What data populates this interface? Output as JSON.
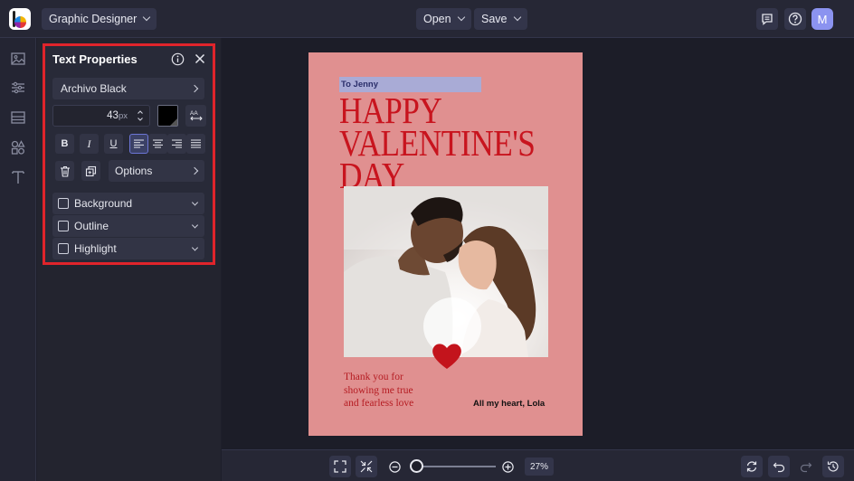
{
  "topbar": {
    "app_mode": "Graphic Designer",
    "open_label": "Open",
    "save_label": "Save",
    "avatar_initial": "M"
  },
  "panel": {
    "title": "Text Properties",
    "font_name": "Archivo Black",
    "font_size": "43",
    "font_unit": "px",
    "text_color": "#000000",
    "format_buttons": {
      "bold": "B",
      "italic": "I",
      "underline": "U"
    },
    "options_label": "Options",
    "sections": [
      {
        "label": "Background",
        "checked": false
      },
      {
        "label": "Outline",
        "checked": false
      },
      {
        "label": "Highlight",
        "checked": false
      }
    ],
    "highlight_color": "#e0242b"
  },
  "card": {
    "to_text": "To Jenny",
    "headline_lines": [
      "HAPPY",
      "VALENTINE'S",
      "DAY"
    ],
    "message": "Thank you for\nshowing me true\nand fearless love",
    "signature": "All my heart, Lola",
    "background_color": "#e09090",
    "headline_color": "#c8141e"
  },
  "zoom": {
    "level": 0.27,
    "label": "27%"
  }
}
